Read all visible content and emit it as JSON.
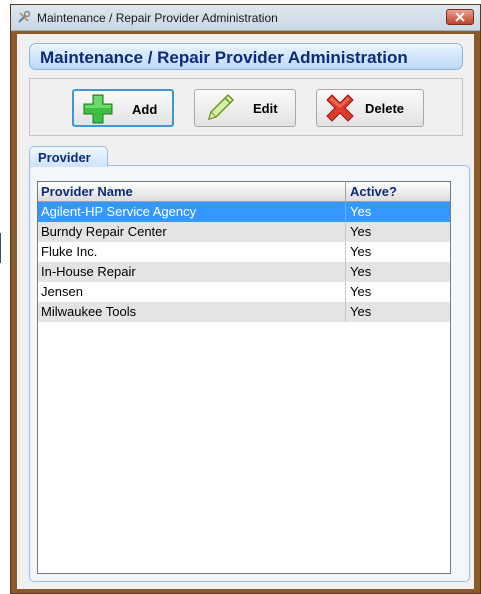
{
  "window": {
    "title": "Maintenance / Repair Provider Administration"
  },
  "header": {
    "title": "Maintenance / Repair Provider Administration"
  },
  "toolbar": {
    "add_label": "Add",
    "edit_label": "Edit",
    "delete_label": "Delete"
  },
  "tab": {
    "label": "Provider"
  },
  "grid": {
    "columns": [
      "Provider Name",
      "Active?"
    ],
    "rows": [
      {
        "name": "Agilent-HP Service Agency",
        "active": "Yes",
        "selected": true
      },
      {
        "name": "Burndy Repair Center",
        "active": "Yes",
        "selected": false
      },
      {
        "name": "Fluke Inc.",
        "active": "Yes",
        "selected": false
      },
      {
        "name": "In-House Repair",
        "active": "Yes",
        "selected": false
      },
      {
        "name": "Jensen",
        "active": "Yes",
        "selected": false
      },
      {
        "name": "Milwaukee Tools",
        "active": "Yes",
        "selected": false
      }
    ]
  },
  "colors": {
    "selection": "#3399ff",
    "header_text": "#0c2b7a",
    "window_frame": "#8a5a2a"
  },
  "icons": {
    "app": "tools-icon",
    "add": "green-plus-icon",
    "edit": "pencil-icon",
    "delete": "red-x-icon",
    "close": "close-icon"
  }
}
